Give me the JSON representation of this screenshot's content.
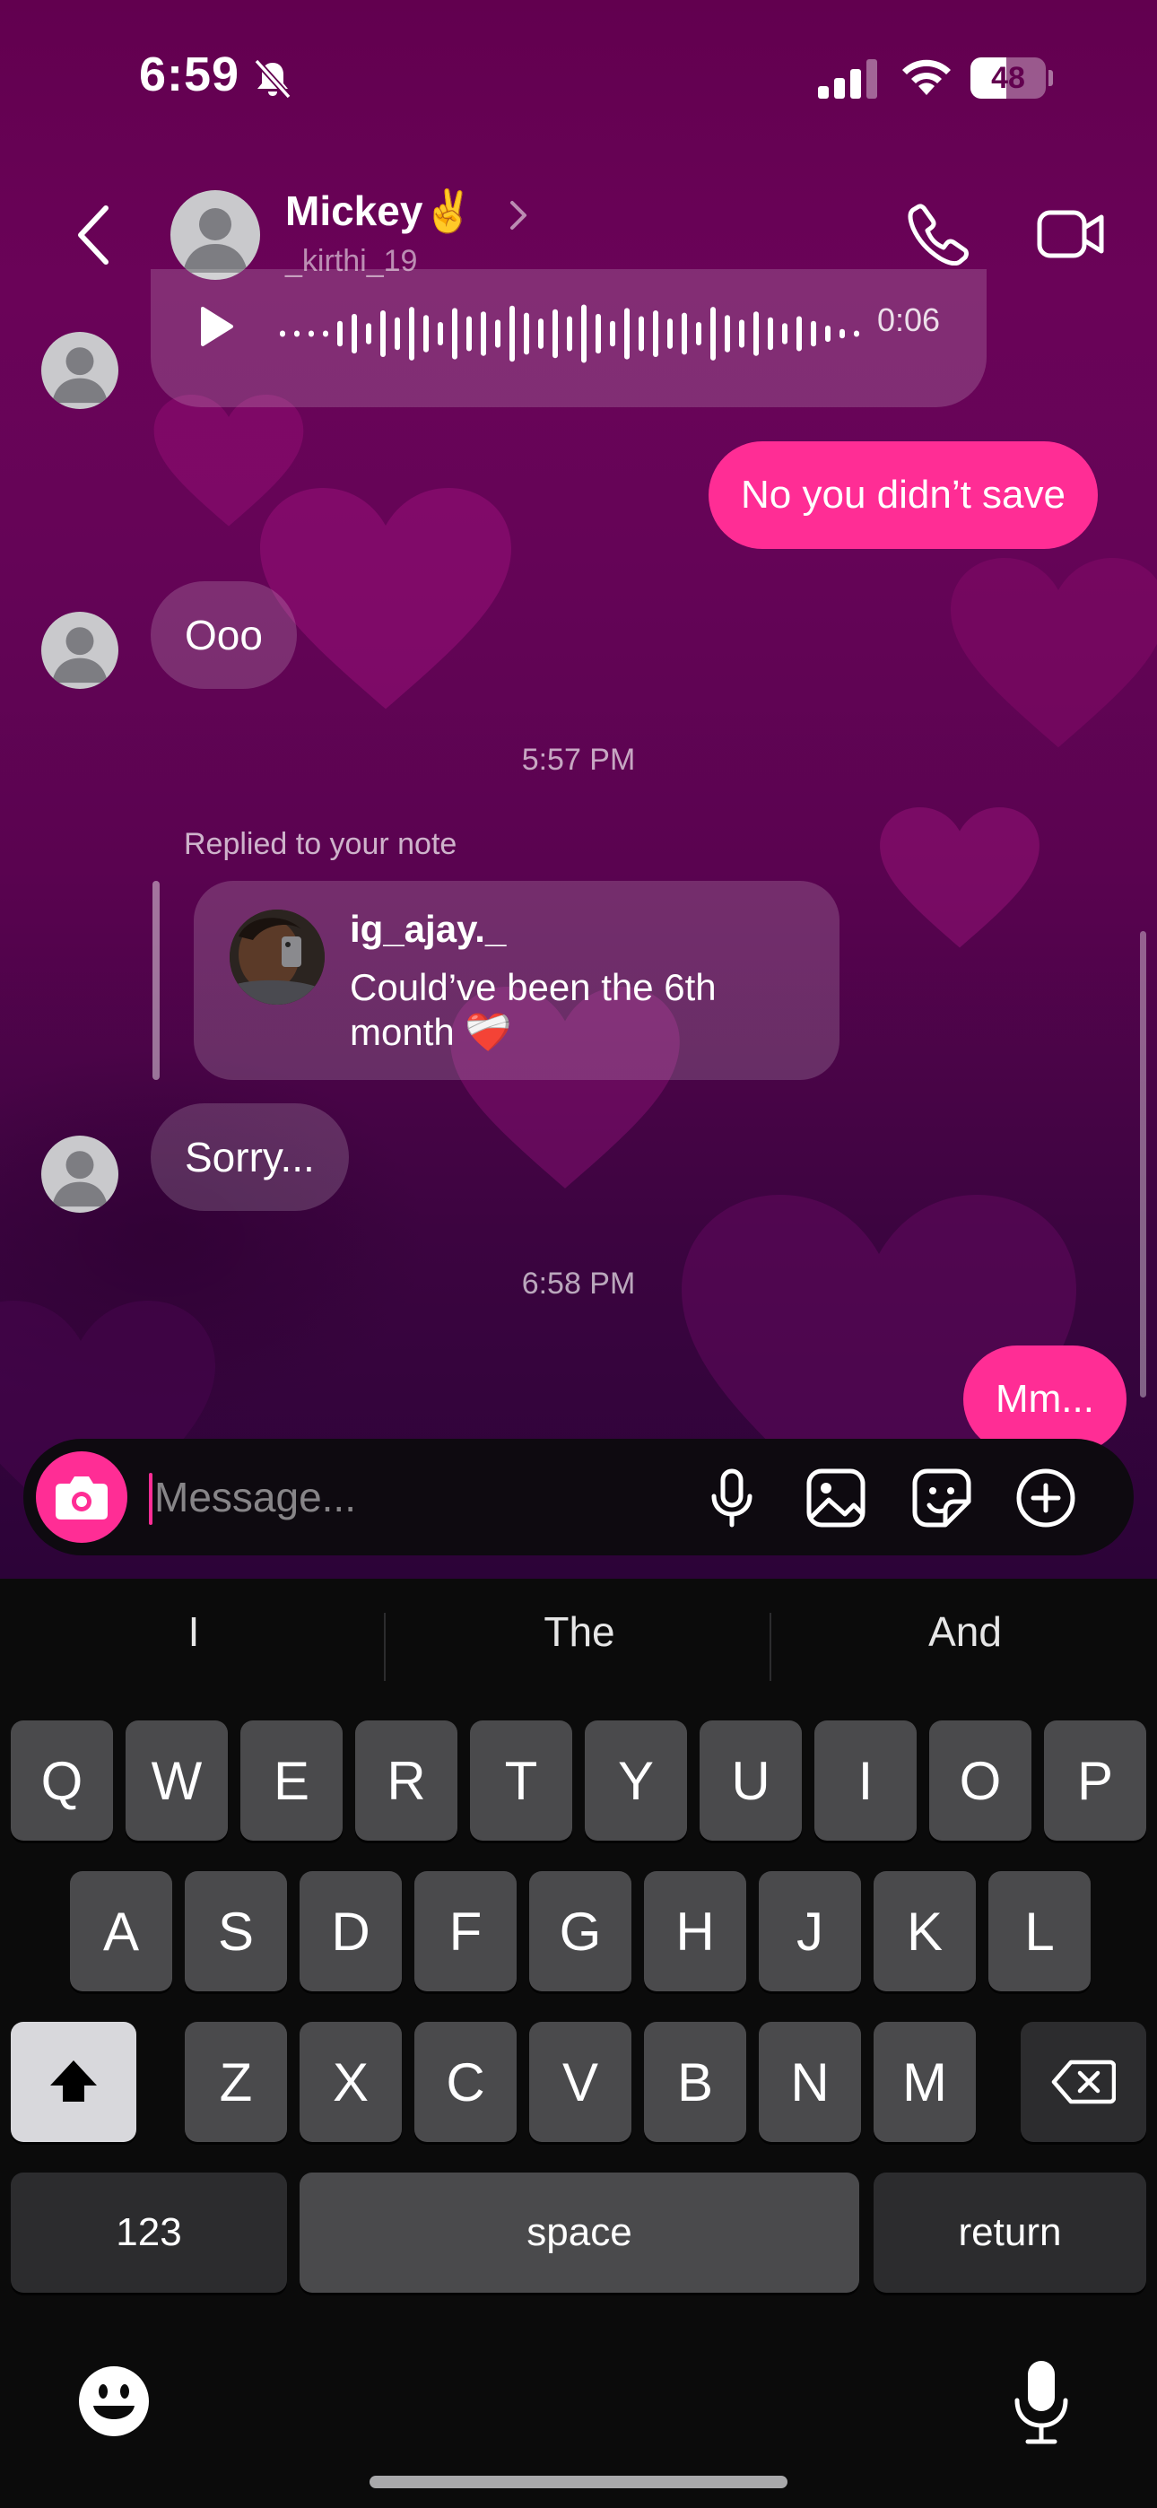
{
  "status_bar": {
    "time": "6:59",
    "battery": "48",
    "battery_level": 0.48
  },
  "header": {
    "name": "Mickey✌️",
    "username": "_kirthi_19"
  },
  "voice_message": {
    "duration": "0:06"
  },
  "messages": {
    "out_1": "No you didn’t save",
    "in_1": "Ooo",
    "timestamp_1": "5:57 PM",
    "reply_label": "Replied to your note",
    "note_user": "ig_ajay._",
    "note_text": "Could’ve been the 6th month ❤️‍🩹",
    "in_2": "Sorry...",
    "timestamp_2": "6:58 PM",
    "out_2": "Mm..."
  },
  "composer": {
    "placeholder": "Message..."
  },
  "keyboard": {
    "suggestions": [
      "I",
      "The",
      "And"
    ],
    "row1": [
      "Q",
      "W",
      "E",
      "R",
      "T",
      "Y",
      "U",
      "I",
      "O",
      "P"
    ],
    "row2": [
      "A",
      "S",
      "D",
      "F",
      "G",
      "H",
      "J",
      "K",
      "L"
    ],
    "row3": [
      "Z",
      "X",
      "C",
      "V",
      "B",
      "N",
      "M"
    ],
    "numbers_label": "123",
    "space_label": "space",
    "return_label": "return"
  },
  "colors": {
    "accent": "#ff2d95",
    "background": "#62004f",
    "keyboard": "#0b0b0b"
  }
}
